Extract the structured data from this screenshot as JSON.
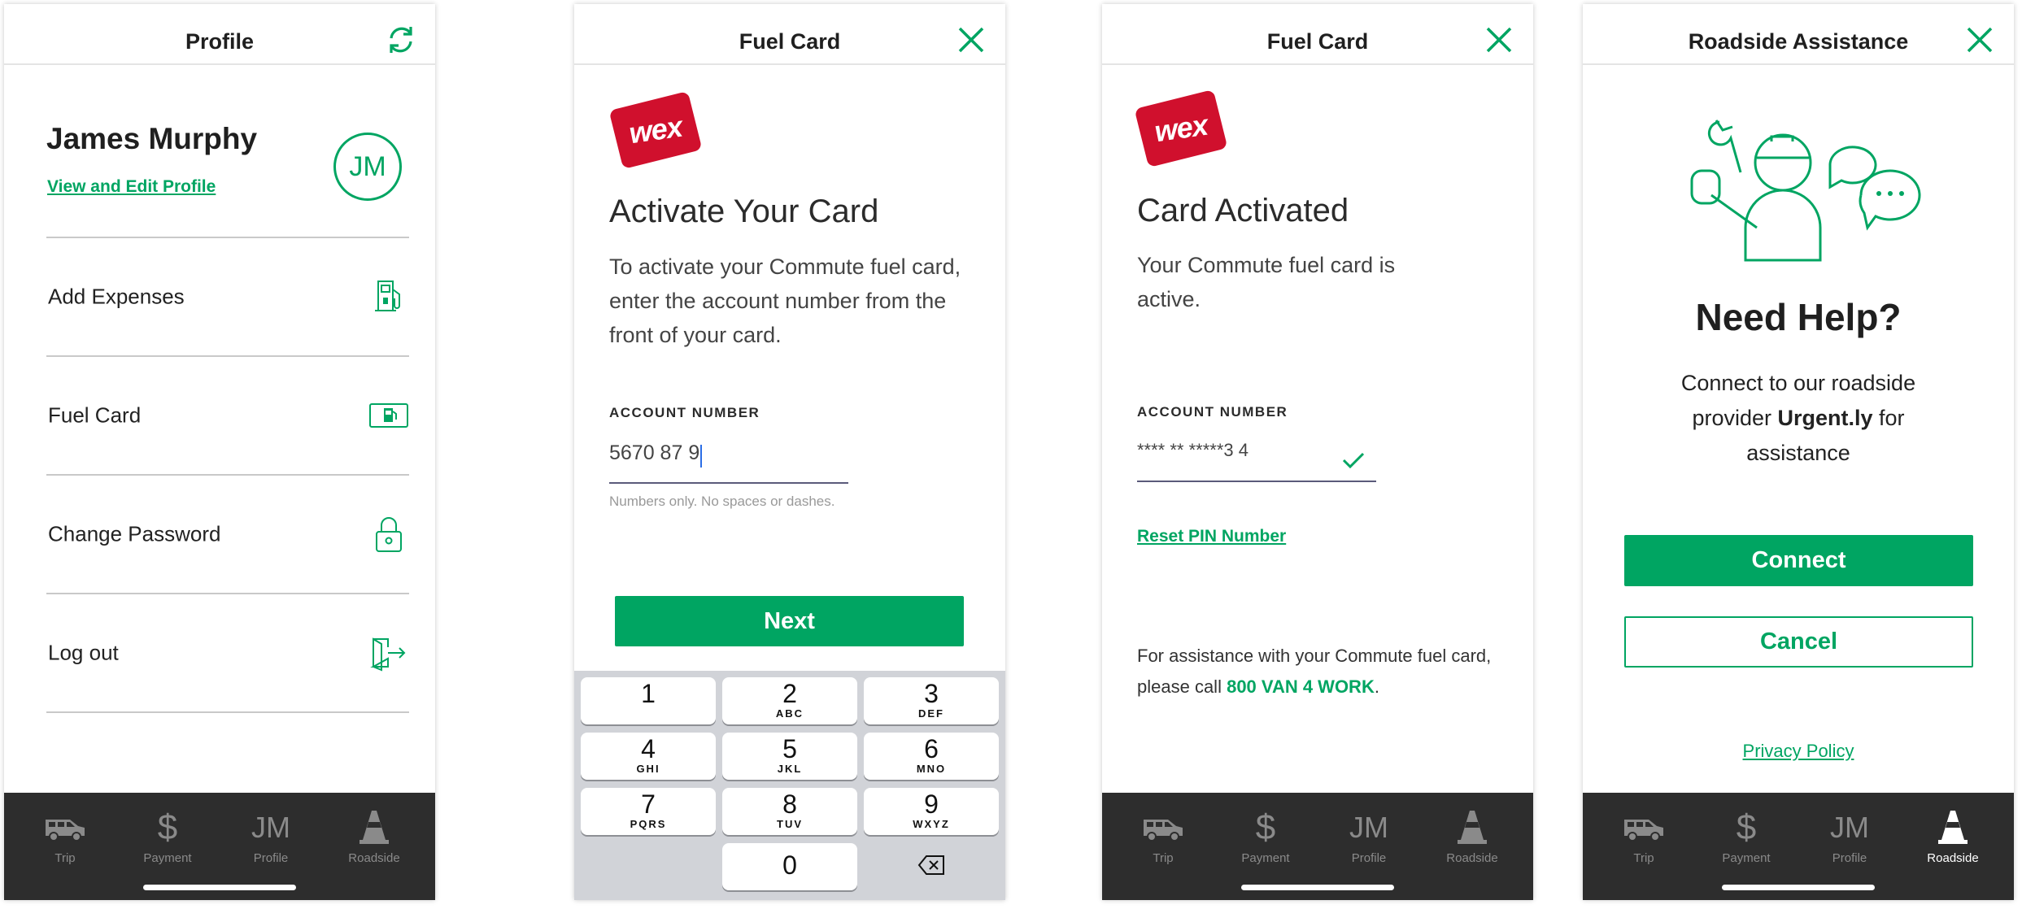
{
  "profile": {
    "title": "Profile",
    "name": "James Murphy",
    "edit_link": "View and Edit Profile",
    "initials": "JM",
    "menu": [
      {
        "label": "Add Expenses",
        "icon": "fuel-pump-icon"
      },
      {
        "label": "Fuel Card",
        "icon": "fuel-card-icon"
      },
      {
        "label": "Change Password",
        "icon": "lock-icon"
      },
      {
        "label": "Log out",
        "icon": "logout-icon"
      }
    ]
  },
  "activate": {
    "title": "Fuel Card",
    "logo": "wex",
    "heading": "Activate Your Card",
    "instructions": "To activate your Commute fuel card, enter the account number from the front of your card.",
    "field_label": "ACCOUNT NUMBER",
    "field_value": "5670 87 9",
    "hint": "Numbers only.  No spaces or dashes.",
    "next_button": "Next",
    "keypad": [
      {
        "digit": "1",
        "letters": ""
      },
      {
        "digit": "2",
        "letters": "ABC"
      },
      {
        "digit": "3",
        "letters": "DEF"
      },
      {
        "digit": "4",
        "letters": "GHI"
      },
      {
        "digit": "5",
        "letters": "JKL"
      },
      {
        "digit": "6",
        "letters": "MNO"
      },
      {
        "digit": "7",
        "letters": "PQRS"
      },
      {
        "digit": "8",
        "letters": "TUV"
      },
      {
        "digit": "9",
        "letters": "WXYZ"
      },
      {
        "digit": "0",
        "letters": ""
      }
    ]
  },
  "activated": {
    "title": "Fuel Card",
    "logo": "wex",
    "heading": "Card Activated",
    "message": "Your Commute fuel card is active.",
    "field_label": "ACCOUNT NUMBER",
    "field_value": "**** ** *****3 4",
    "reset_link": "Reset PIN Number",
    "assist_prefix": "For assistance with your Commute fuel card, please call ",
    "assist_phone": "800 VAN 4 WORK",
    "assist_suffix": "."
  },
  "roadside": {
    "title": "Roadside Assistance",
    "heading": "Need Help?",
    "line1": "Connect to our roadside",
    "line2_prefix": "provider ",
    "provider": "Urgent.ly",
    "line2_suffix": " for",
    "line3": "assistance",
    "connect_button": "Connect",
    "cancel_button": "Cancel",
    "privacy_link": "Privacy Policy"
  },
  "tabs": [
    {
      "label": "Trip",
      "icon": "van-icon"
    },
    {
      "label": "Payment",
      "icon": "dollar-icon"
    },
    {
      "label": "Profile",
      "icon": "initials-icon",
      "text": "JM"
    },
    {
      "label": "Roadside",
      "icon": "traffic-cone-icon"
    }
  ],
  "colors": {
    "accent": "#00a562",
    "wex_red": "#d0102d",
    "tabbar": "#2d2d2d"
  }
}
